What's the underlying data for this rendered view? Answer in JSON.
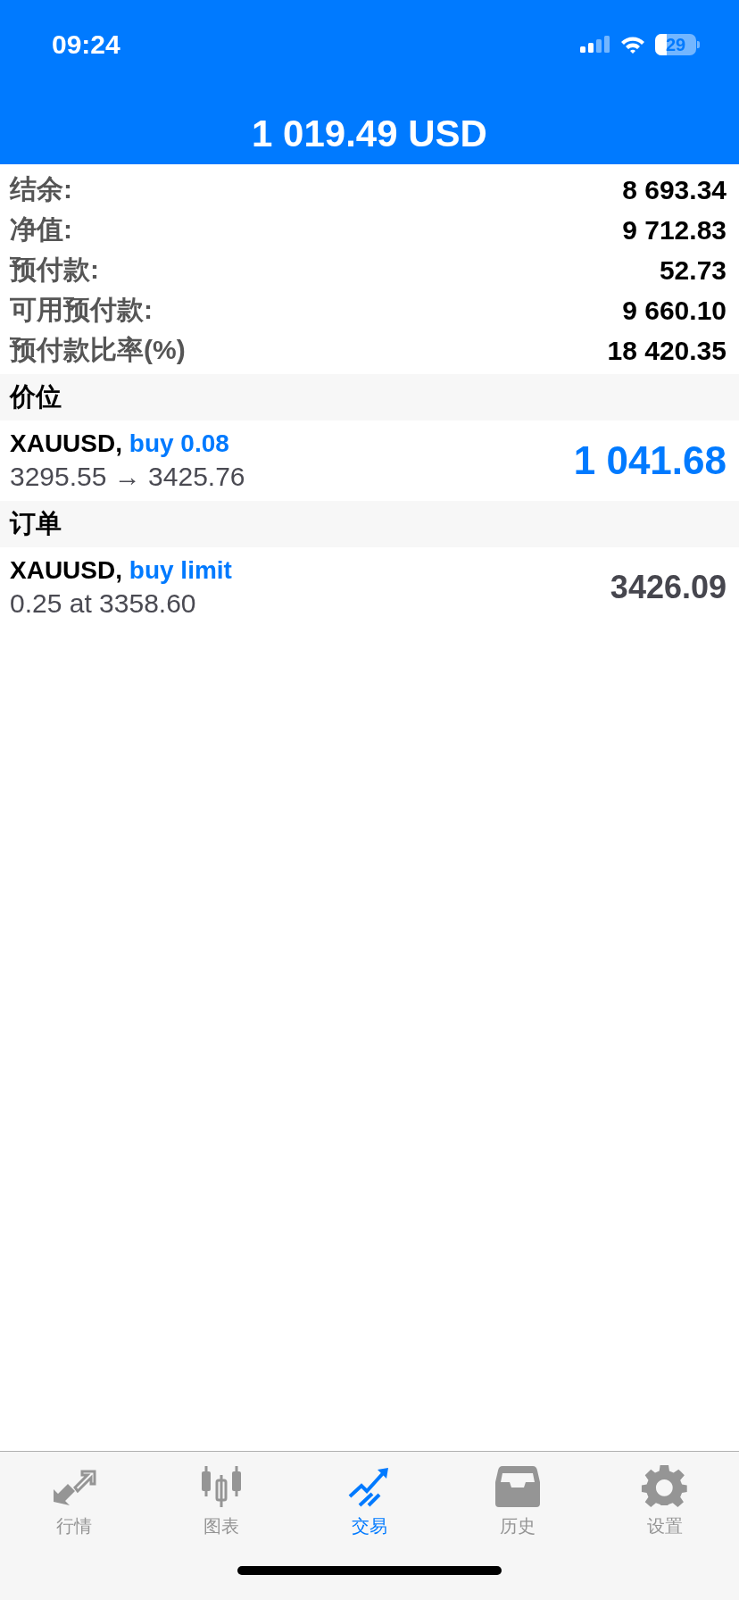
{
  "status_bar": {
    "time": "09:24",
    "battery": "29"
  },
  "header": {
    "balance": "1 019.49 USD"
  },
  "summary": [
    {
      "label": "结余:",
      "value": "8 693.34"
    },
    {
      "label": "净值:",
      "value": "9 712.83"
    },
    {
      "label": "预付款:",
      "value": "52.73"
    },
    {
      "label": "可用预付款:",
      "value": "9 660.10"
    },
    {
      "label": "预付款比率(%)",
      "value": "18 420.35"
    }
  ],
  "sections": [
    {
      "title": "价位",
      "rows": [
        {
          "kind": "position",
          "symbol": "XAUUSD,",
          "type": "buy 0.08",
          "detail": "3295.55 → 3425.76",
          "value": "1 041.68"
        }
      ]
    },
    {
      "title": "订单",
      "rows": [
        {
          "kind": "order",
          "symbol": "XAUUSD,",
          "type": "buy limit",
          "detail": "0.25 at 3358.60",
          "value": "3426.09"
        }
      ]
    }
  ],
  "tabs": [
    {
      "label": "行情",
      "selected": false
    },
    {
      "label": "图表",
      "selected": false
    },
    {
      "label": "交易",
      "selected": true
    },
    {
      "label": "历史",
      "selected": false
    },
    {
      "label": "设置",
      "selected": false
    }
  ]
}
